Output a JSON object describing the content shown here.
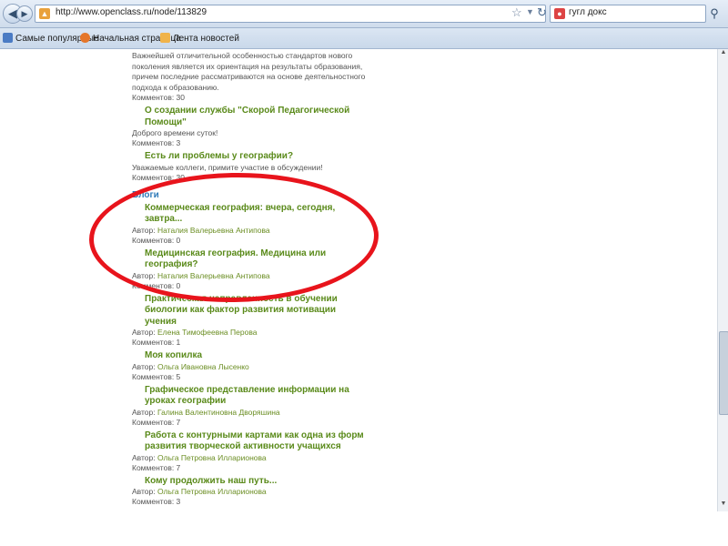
{
  "browser": {
    "url": "http://www.openclass.ru/node/113829",
    "search_query": "гугл докс",
    "back_icon": "back-arrow-icon",
    "forward_icon": "forward-arrow-icon",
    "bookmarks": [
      "Самые популярные",
      "Начальная страница",
      "Лента новостей"
    ]
  },
  "content": {
    "intro_text": "Важнейшей отличительной особенностью стандартов нового поколения является их ориентация на результаты образования, причем последние рассматриваются на основе деятельностного подхода к образованию.",
    "intro_comments": "Комментов: 30",
    "forum_items": [
      {
        "title": "О создании службы \"Скорой Педагогической Помощи\"",
        "desc": "Доброго времени суток!",
        "comments": "Комментов: 3"
      },
      {
        "title": "Есть ли проблемы у географии?",
        "desc": "Уважаемые коллеги, примите участие в обсуждении!",
        "comments": "Комментов: 30"
      }
    ],
    "blogs_heading": "Блоги",
    "author_prefix": "Автор:",
    "blog_items": [
      {
        "title": "Коммерческая география: вчера, сегодня, завтра...",
        "author": "Наталия Валерьевна Антипова",
        "comments": "Комментов: 0"
      },
      {
        "title": "Медицинская география. Медицина или география?",
        "author": "Наталия Валерьевна Антипова",
        "comments": "Комментов: 0"
      },
      {
        "title": "Практическая направленность в обучении биологии как фактор развития мотивации учения",
        "author": "Елена Тимофеевна Перова",
        "comments": "Комментов: 1"
      },
      {
        "title": "Моя копилка",
        "author": "Ольга Ивановна Лысенко",
        "comments": "Комментов: 5"
      },
      {
        "title": "Графическое представление информации на уроках географии",
        "author": "Галина Валентиновна Дворяшина",
        "comments": "Комментов: 7"
      },
      {
        "title": "Работа с контурными картами как одна из форм развития творческой активности учащихся",
        "author": "Ольга Петровна Илларионова",
        "comments": "Комментов: 7"
      },
      {
        "title": "Кому продолжить наш путь...",
        "author": "Ольга Петровна Илларионова",
        "comments": "Комментов: 3"
      }
    ]
  },
  "colors": {
    "link_green": "#5a8a1a",
    "heading_blue": "#2f7ab8",
    "highlight_red": "#e8141c"
  }
}
